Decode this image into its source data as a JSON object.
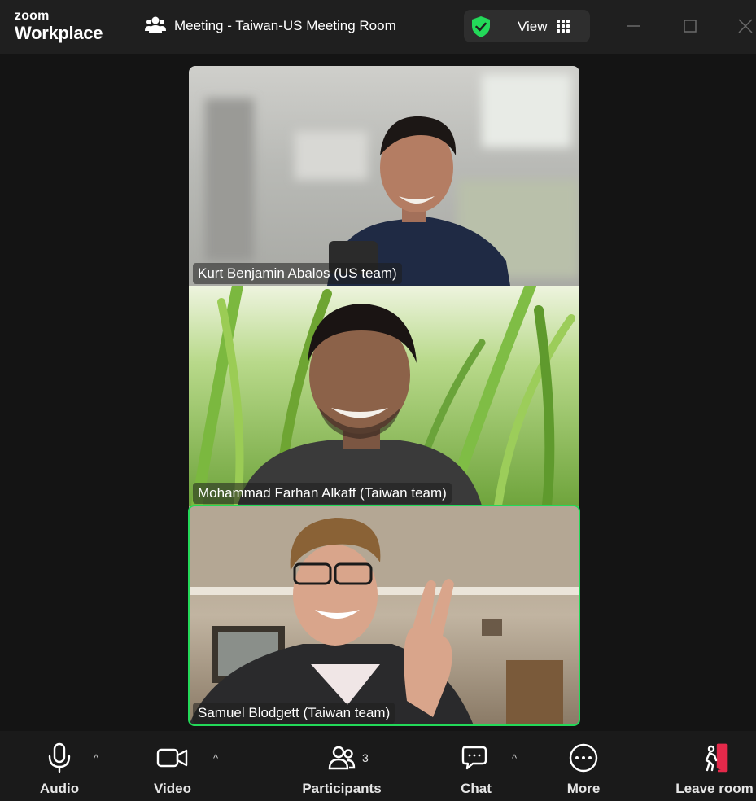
{
  "app": {
    "logo_top": "zoom",
    "logo_bottom": "Workplace"
  },
  "header": {
    "meeting_title": "Meeting - Taiwan-US Meeting Room",
    "view_label": "View"
  },
  "participants": [
    {
      "name": "Kurt Benjamin Abalos (US team)"
    },
    {
      "name": "Mohammad Farhan Alkaff (Taiwan team)"
    },
    {
      "name": "Samuel Blodgett (Taiwan team)",
      "active_speaker": true
    }
  ],
  "toolbar": {
    "audio": "Audio",
    "video": "Video",
    "participants": "Participants",
    "participants_count": "3",
    "chat": "Chat",
    "more": "More",
    "leave": "Leave room"
  },
  "colors": {
    "accent_green": "#23d959",
    "leave_red": "#e5294a",
    "background": "#141414"
  },
  "icons": [
    "participants-icon",
    "shield-check-icon",
    "grid-icon",
    "minimize-icon",
    "maximize-icon",
    "close-icon",
    "microphone-icon",
    "video-camera-icon",
    "chat-icon",
    "more-icon",
    "leave-icon",
    "chevron-up-icon"
  ]
}
